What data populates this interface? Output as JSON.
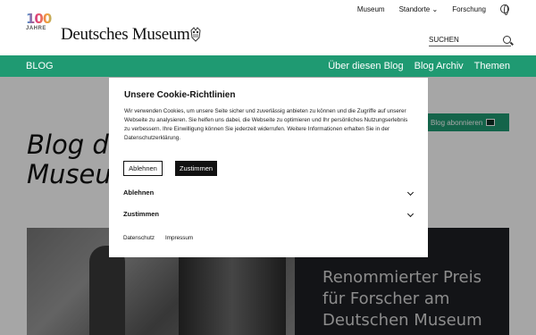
{
  "topnav": {
    "items": [
      "Museum",
      "Standorte",
      "Forschung"
    ]
  },
  "logo": {
    "anniversary_number": "100",
    "anniversary_word": "JAHRE",
    "brand": "Deutsches Museum"
  },
  "search": {
    "label": "SUCHEN"
  },
  "greenbar": {
    "section": "BLOG",
    "menu": [
      "Über diesen Blog",
      "Blog Archiv",
      "Themen"
    ]
  },
  "page": {
    "title_line1": "Blog d",
    "title_line2": "Museu",
    "subscribe_label": "Blog abonnieren",
    "teaser_lines": [
      "Renommierter Preis",
      "für Forscher am",
      "Deutschen Museum"
    ]
  },
  "cookie": {
    "title": "Unsere Cookie-Richtlinien",
    "text": "Wir verwenden Cookies, um unsere Seite sicher und zuverlässig anbieten zu können und die Zugriffe auf unserer Webseite zu analysieren. Sie helfen uns dabei, die Webseite zu optimieren und Ihr persönliches Nutzungserlebnis zu verbessern. Ihre Einwilligung können Sie jederzeit widerrufen. Weitere Informationen erhalten Sie in der Datenschutzerklärung.",
    "reject_label": "Ablehnen",
    "accept_label": "Zustimmen",
    "section_reject": "Ablehnen",
    "section_accept": "Zustimmen",
    "link_privacy": "Datenschutz",
    "link_imprint": "Impressum"
  },
  "colors": {
    "accent_green": "#1f9a72",
    "teaser_bg": "#1e1f24"
  }
}
